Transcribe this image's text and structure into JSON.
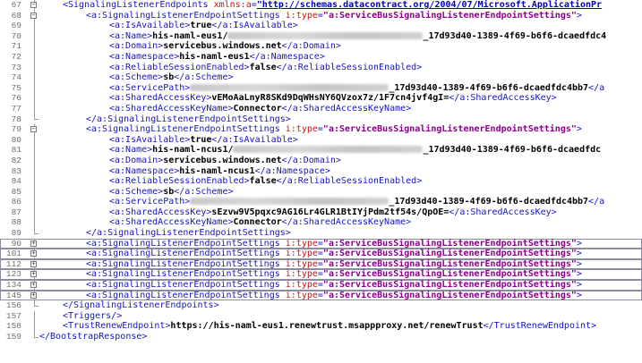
{
  "lines": [
    {
      "num": "67",
      "indent": 1,
      "fold": "box-minus",
      "parts": [
        {
          "c": "t",
          "t": "<SignalingListenerEndpoints "
        },
        {
          "c": "a",
          "t": "xmlns:a"
        },
        {
          "c": "t",
          "t": "="
        },
        {
          "c": "u",
          "t": "\"http://schemas.datacontract.org/2004/07/Microsoft.ApplicationPr"
        }
      ]
    },
    {
      "num": "68",
      "indent": 2,
      "fold": "box-minus",
      "parts": [
        {
          "c": "t",
          "t": "<a:SignalingListenerEndpointSettings "
        },
        {
          "c": "a",
          "t": "i:type"
        },
        {
          "c": "t",
          "t": "="
        },
        {
          "c": "s",
          "t": "\"a:ServiceBusSignalingListenerEndpointSettings\""
        },
        {
          "c": "t",
          "t": ">"
        }
      ]
    },
    {
      "num": "69",
      "indent": 3,
      "fold": "line",
      "parts": [
        {
          "c": "t",
          "t": "<a:IsAvailable>"
        },
        {
          "c": "v",
          "t": "true"
        },
        {
          "c": "t",
          "t": "</a:IsAvailable>"
        }
      ]
    },
    {
      "num": "70",
      "indent": 3,
      "fold": "line",
      "parts": [
        {
          "c": "t",
          "t": "<a:Name>"
        },
        {
          "c": "v",
          "t": "his-naml-eus1/"
        },
        {
          "c": "blur",
          "w": 218
        },
        {
          "c": "v",
          "t": "_17d93d40-1389-4f69-b6f6-dcaedfdc4"
        }
      ]
    },
    {
      "num": "71",
      "indent": 3,
      "fold": "line",
      "parts": [
        {
          "c": "t",
          "t": "<a:Domain>"
        },
        {
          "c": "v",
          "t": "servicebus.windows.net"
        },
        {
          "c": "t",
          "t": "</a:Domain>"
        }
      ]
    },
    {
      "num": "72",
      "indent": 3,
      "fold": "line",
      "parts": [
        {
          "c": "t",
          "t": "<a:Namespace>"
        },
        {
          "c": "v",
          "t": "his-naml-eus1"
        },
        {
          "c": "t",
          "t": "</a:Namespace>"
        }
      ]
    },
    {
      "num": "73",
      "indent": 3,
      "fold": "line",
      "parts": [
        {
          "c": "t",
          "t": "<a:ReliableSessionEnabled>"
        },
        {
          "c": "v",
          "t": "false"
        },
        {
          "c": "t",
          "t": "</a:ReliableSessionEnabled>"
        }
      ]
    },
    {
      "num": "74",
      "indent": 3,
      "fold": "line",
      "parts": [
        {
          "c": "t",
          "t": "<a:Scheme>"
        },
        {
          "c": "v",
          "t": "sb"
        },
        {
          "c": "t",
          "t": "</a:Scheme>"
        }
      ]
    },
    {
      "num": "75",
      "indent": 3,
      "fold": "line",
      "parts": [
        {
          "c": "t",
          "t": "<a:ServicePath>"
        },
        {
          "c": "blur",
          "w": 222
        },
        {
          "c": "v",
          "t": "_17d93d40-1389-4f69-b6f6-dcaedfdc4bb7"
        },
        {
          "c": "t",
          "t": "</a"
        }
      ]
    },
    {
      "num": "76",
      "indent": 3,
      "fold": "line",
      "parts": [
        {
          "c": "t",
          "t": "<a:SharedAccessKey>"
        },
        {
          "c": "v",
          "t": "vEMoAaLnyR8SKd9DqWHsNY6QVzox7z/1F7cn4jvf4gI="
        },
        {
          "c": "t",
          "t": "</a:SharedAccessKey>"
        }
      ]
    },
    {
      "num": "77",
      "indent": 3,
      "fold": "line",
      "parts": [
        {
          "c": "t",
          "t": "<a:SharedAccessKeyName>"
        },
        {
          "c": "v",
          "t": "Connector"
        },
        {
          "c": "t",
          "t": "</a:SharedAccessKeyName>"
        }
      ]
    },
    {
      "num": "78",
      "indent": 2,
      "fold": "end",
      "parts": [
        {
          "c": "t",
          "t": "</a:SignalingListenerEndpointSettings>"
        }
      ]
    },
    {
      "num": "79",
      "indent": 2,
      "fold": "box-minus",
      "parts": [
        {
          "c": "t",
          "t": "<a:SignalingListenerEndpointSettings "
        },
        {
          "c": "a",
          "t": "i:type"
        },
        {
          "c": "t",
          "t": "="
        },
        {
          "c": "s",
          "t": "\"a:ServiceBusSignalingListenerEndpointSettings\""
        },
        {
          "c": "t",
          "t": ">"
        }
      ]
    },
    {
      "num": "80",
      "indent": 3,
      "fold": "line",
      "parts": [
        {
          "c": "t",
          "t": "<a:IsAvailable>"
        },
        {
          "c": "v",
          "t": "true"
        },
        {
          "c": "t",
          "t": "</a:IsAvailable>"
        }
      ]
    },
    {
      "num": "81",
      "indent": 3,
      "fold": "line",
      "parts": [
        {
          "c": "t",
          "t": "<a:Name>"
        },
        {
          "c": "v",
          "t": "his-naml-ncus1/"
        },
        {
          "c": "blur",
          "w": 212
        },
        {
          "c": "v",
          "t": "_17d93d40-1389-4f69-b6f6-dcaedfdc"
        }
      ]
    },
    {
      "num": "82",
      "indent": 3,
      "fold": "line",
      "parts": [
        {
          "c": "t",
          "t": "<a:Domain>"
        },
        {
          "c": "v",
          "t": "servicebus.windows.net"
        },
        {
          "c": "t",
          "t": "</a:Domain>"
        }
      ]
    },
    {
      "num": "83",
      "indent": 3,
      "fold": "line",
      "parts": [
        {
          "c": "t",
          "t": "<a:Namespace>"
        },
        {
          "c": "v",
          "t": "his-naml-ncus1"
        },
        {
          "c": "t",
          "t": "</a:Namespace>"
        }
      ]
    },
    {
      "num": "84",
      "indent": 3,
      "fold": "line",
      "parts": [
        {
          "c": "t",
          "t": "<a:ReliableSessionEnabled>"
        },
        {
          "c": "v",
          "t": "false"
        },
        {
          "c": "t",
          "t": "</a:ReliableSessionEnabled>"
        }
      ]
    },
    {
      "num": "85",
      "indent": 3,
      "fold": "line",
      "parts": [
        {
          "c": "t",
          "t": "<a:Scheme>"
        },
        {
          "c": "v",
          "t": "sb"
        },
        {
          "c": "t",
          "t": "</a:Scheme>"
        }
      ]
    },
    {
      "num": "86",
      "indent": 3,
      "fold": "line",
      "parts": [
        {
          "c": "t",
          "t": "<a:ServicePath>"
        },
        {
          "c": "blur",
          "w": 222
        },
        {
          "c": "v",
          "t": "_17d93d40-1389-4f69-b6f6-dcaedfdc4bb7"
        },
        {
          "c": "t",
          "t": "</a"
        }
      ]
    },
    {
      "num": "87",
      "indent": 3,
      "fold": "line",
      "parts": [
        {
          "c": "t",
          "t": "<a:SharedAccessKey>"
        },
        {
          "c": "v",
          "t": "sEzvw9V5pqxc9AG16Lr4GLR1BtIYjPdm2tf54s/QpOE="
        },
        {
          "c": "t",
          "t": "</a:SharedAccessKey>"
        }
      ]
    },
    {
      "num": "88",
      "indent": 3,
      "fold": "line",
      "parts": [
        {
          "c": "t",
          "t": "<a:SharedAccessKeyName>"
        },
        {
          "c": "v",
          "t": "Connector"
        },
        {
          "c": "t",
          "t": "</a:SharedAccessKeyName>"
        }
      ]
    },
    {
      "num": "89",
      "indent": 2,
      "fold": "end",
      "parts": [
        {
          "c": "t",
          "t": "</a:SignalingListenerEndpointSettings>"
        }
      ]
    },
    {
      "num": "90",
      "indent": 2,
      "fold": "box-plus",
      "boxed": true,
      "parts": [
        {
          "c": "t",
          "t": "<a:SignalingListenerEndpointSettings "
        },
        {
          "c": "a",
          "t": "i:type"
        },
        {
          "c": "t",
          "t": "="
        },
        {
          "c": "s",
          "t": "\"a:ServiceBusSignalingListenerEndpointSettings\""
        },
        {
          "c": "t",
          "t": ">"
        }
      ]
    },
    {
      "num": "101",
      "indent": 2,
      "fold": "box-plus",
      "boxed": true,
      "parts": [
        {
          "c": "t",
          "t": "<a:SignalingListenerEndpointSettings "
        },
        {
          "c": "a",
          "t": "i:type"
        },
        {
          "c": "t",
          "t": "="
        },
        {
          "c": "s",
          "t": "\"a:ServiceBusSignalingListenerEndpointSettings\""
        },
        {
          "c": "t",
          "t": ">"
        }
      ]
    },
    {
      "num": "112",
      "indent": 2,
      "fold": "box-plus",
      "boxed": true,
      "parts": [
        {
          "c": "t",
          "t": "<a:SignalingListenerEndpointSettings "
        },
        {
          "c": "a",
          "t": "i:type"
        },
        {
          "c": "t",
          "t": "="
        },
        {
          "c": "s",
          "t": "\"a:ServiceBusSignalingListenerEndpointSettings\""
        },
        {
          "c": "t",
          "t": ">"
        }
      ]
    },
    {
      "num": "123",
      "indent": 2,
      "fold": "box-plus",
      "boxed": true,
      "parts": [
        {
          "c": "t",
          "t": "<a:SignalingListenerEndpointSettings "
        },
        {
          "c": "a",
          "t": "i:type"
        },
        {
          "c": "t",
          "t": "="
        },
        {
          "c": "s",
          "t": "\"a:ServiceBusSignalingListenerEndpointSettings\""
        },
        {
          "c": "t",
          "t": ">"
        }
      ]
    },
    {
      "num": "134",
      "indent": 2,
      "fold": "box-plus",
      "boxed": true,
      "parts": [
        {
          "c": "t",
          "t": "<a:SignalingListenerEndpointSettings "
        },
        {
          "c": "a",
          "t": "i:type"
        },
        {
          "c": "t",
          "t": "="
        },
        {
          "c": "s",
          "t": "\"a:ServiceBusSignalingListenerEndpointSettings\""
        },
        {
          "c": "t",
          "t": ">"
        }
      ]
    },
    {
      "num": "145",
      "indent": 2,
      "fold": "box-plus",
      "boxed": true,
      "parts": [
        {
          "c": "t",
          "t": "<a:SignalingListenerEndpointSettings "
        },
        {
          "c": "a",
          "t": "i:type"
        },
        {
          "c": "t",
          "t": "="
        },
        {
          "c": "s",
          "t": "\"a:ServiceBusSignalingListenerEndpointSettings\""
        },
        {
          "c": "t",
          "t": ">"
        }
      ]
    },
    {
      "num": "156",
      "indent": 1,
      "fold": "end",
      "parts": [
        {
          "c": "t",
          "t": "</SignalingListenerEndpoints>"
        }
      ]
    },
    {
      "num": "157",
      "indent": 1,
      "fold": "line",
      "parts": [
        {
          "c": "t",
          "t": "<Triggers/>"
        }
      ]
    },
    {
      "num": "158",
      "indent": 1,
      "fold": "line",
      "parts": [
        {
          "c": "t",
          "t": "<TrustRenewEndpoint>"
        },
        {
          "c": "v",
          "t": "https://his-naml-eus1.renewtrust.msappproxy.net/renewTrust"
        },
        {
          "c": "t",
          "t": "</TrustRenewEndpoint>"
        }
      ]
    },
    {
      "num": "159",
      "indent": 0,
      "fold": "end",
      "parts": [
        {
          "c": "t",
          "t": "</BootstrapResponse>"
        }
      ]
    }
  ]
}
